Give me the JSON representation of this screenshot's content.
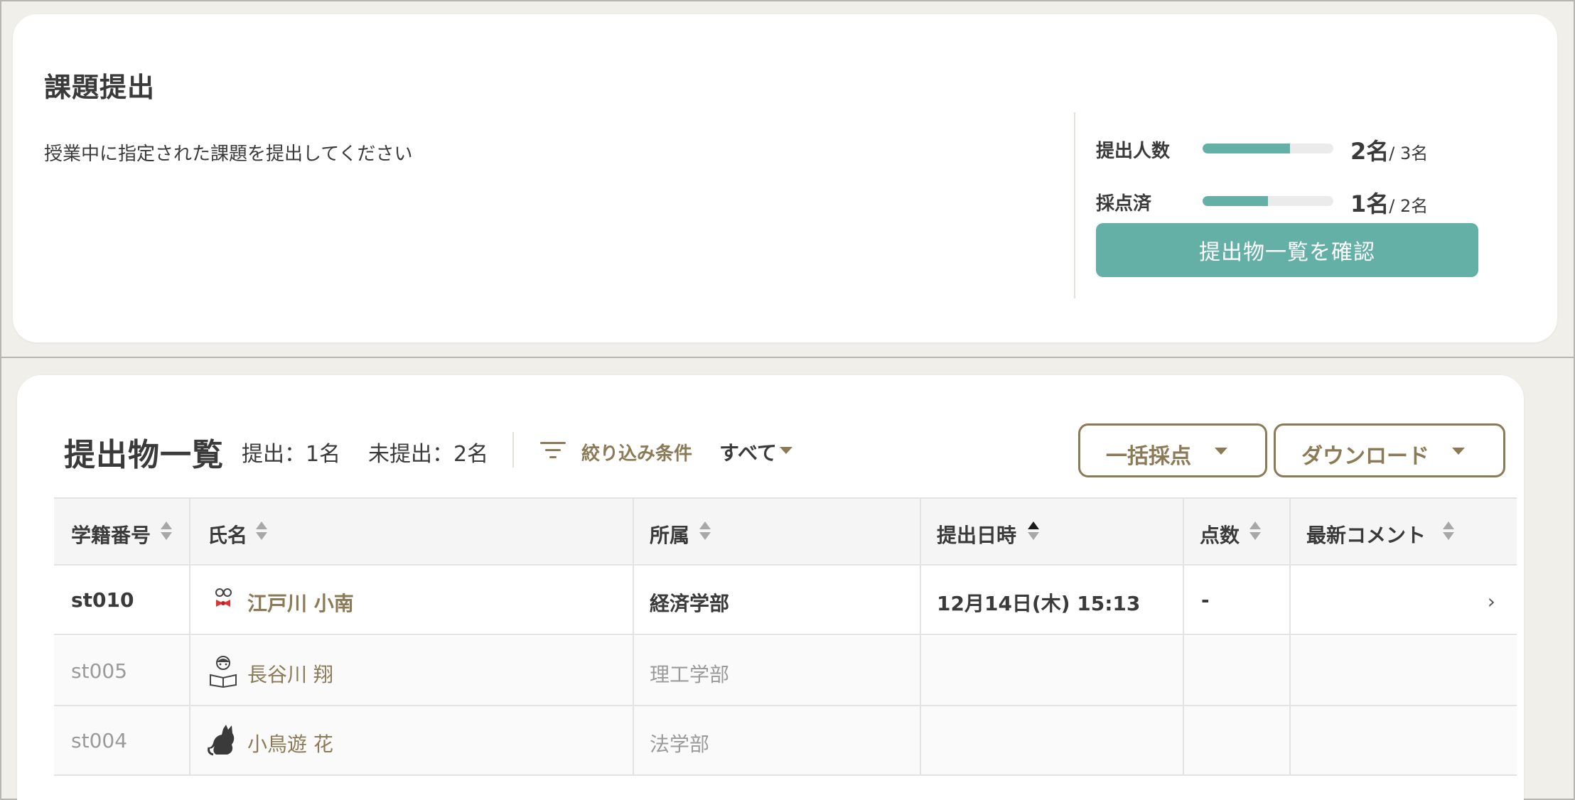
{
  "assignment": {
    "title": "課題提出",
    "description": "授業中に指定された課題を提出してください",
    "stats": [
      {
        "label": "提出人数",
        "value": "2名",
        "total": "/ 3名",
        "progress": 0.67
      },
      {
        "label": "採点済",
        "value": "1名",
        "total": "/ 2名",
        "progress": 0.5
      }
    ],
    "confirm_button": "提出物一覧を確認"
  },
  "submissions": {
    "title": "提出物一覧",
    "submitted_count": "提出：1名",
    "unsubmitted_count": "未提出：2名",
    "filter_label": "絞り込み条件",
    "filter_value": "すべて",
    "bulk_grade_button": "一括採点",
    "download_button": "ダウンロード",
    "columns": [
      "学籍番号",
      "氏名",
      "所属",
      "提出日時",
      "点数",
      "最新コメント"
    ],
    "rows": [
      {
        "id": "st010",
        "name": "江戸川 小南",
        "dept": "経済学部",
        "date": "12月14日(木) 15:13",
        "score": "-",
        "comment": "",
        "avatar": "bowtie-glasses-icon"
      },
      {
        "id": "st005",
        "name": "長谷川 翔",
        "dept": "理工学部",
        "date": "",
        "score": "",
        "comment": "",
        "avatar": "reading-person-icon"
      },
      {
        "id": "st004",
        "name": "小鳥遊 花",
        "dept": "法学部",
        "date": "",
        "score": "",
        "comment": "",
        "avatar": "cat-icon"
      }
    ]
  },
  "colors": {
    "accent": "#64b0a7",
    "brand": "#8b7a55"
  }
}
